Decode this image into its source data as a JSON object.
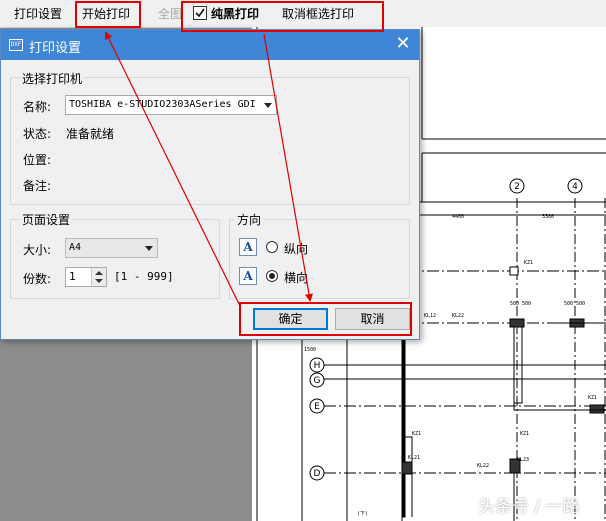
{
  "toolbar": {
    "print_settings": "打印设置",
    "start_print": "开始打印",
    "full_view": "全图",
    "pure_black_print": "纯黑打印",
    "cancel_selection_print": "取消框选打印",
    "pure_black_checked": true
  },
  "dialog": {
    "icon_text": "DXF",
    "title": "打印设置",
    "printer_group": {
      "title": "选择打印机",
      "name_label": "名称:",
      "name_value": "TOSHIBA e-STUDIO2303ASeries GDI",
      "status_label": "状态:",
      "status_value": "准备就绪",
      "location_label": "位置:",
      "comment_label": "备注:"
    },
    "page_group": {
      "title": "页面设置",
      "size_label": "大小:",
      "size_value": "A4",
      "copies_label": "份数:",
      "copies_value": "1",
      "copies_range": "[1 - 999]"
    },
    "orientation_group": {
      "title": "方向",
      "icon_letter": "A",
      "portrait": "纵向",
      "landscape": "横向",
      "selected": "landscape"
    },
    "ok_button": "确定",
    "cancel_button": "取消"
  },
  "drawing": {
    "axis_2": "2",
    "axis_4": "4",
    "axis_h": "H",
    "axis_g": "G",
    "axis_e": "E",
    "axis_d": "D"
  },
  "watermark": "头条号 / 一路",
  "colors": {
    "accent": "#3f86d6",
    "highlight_red": "#e00000"
  }
}
